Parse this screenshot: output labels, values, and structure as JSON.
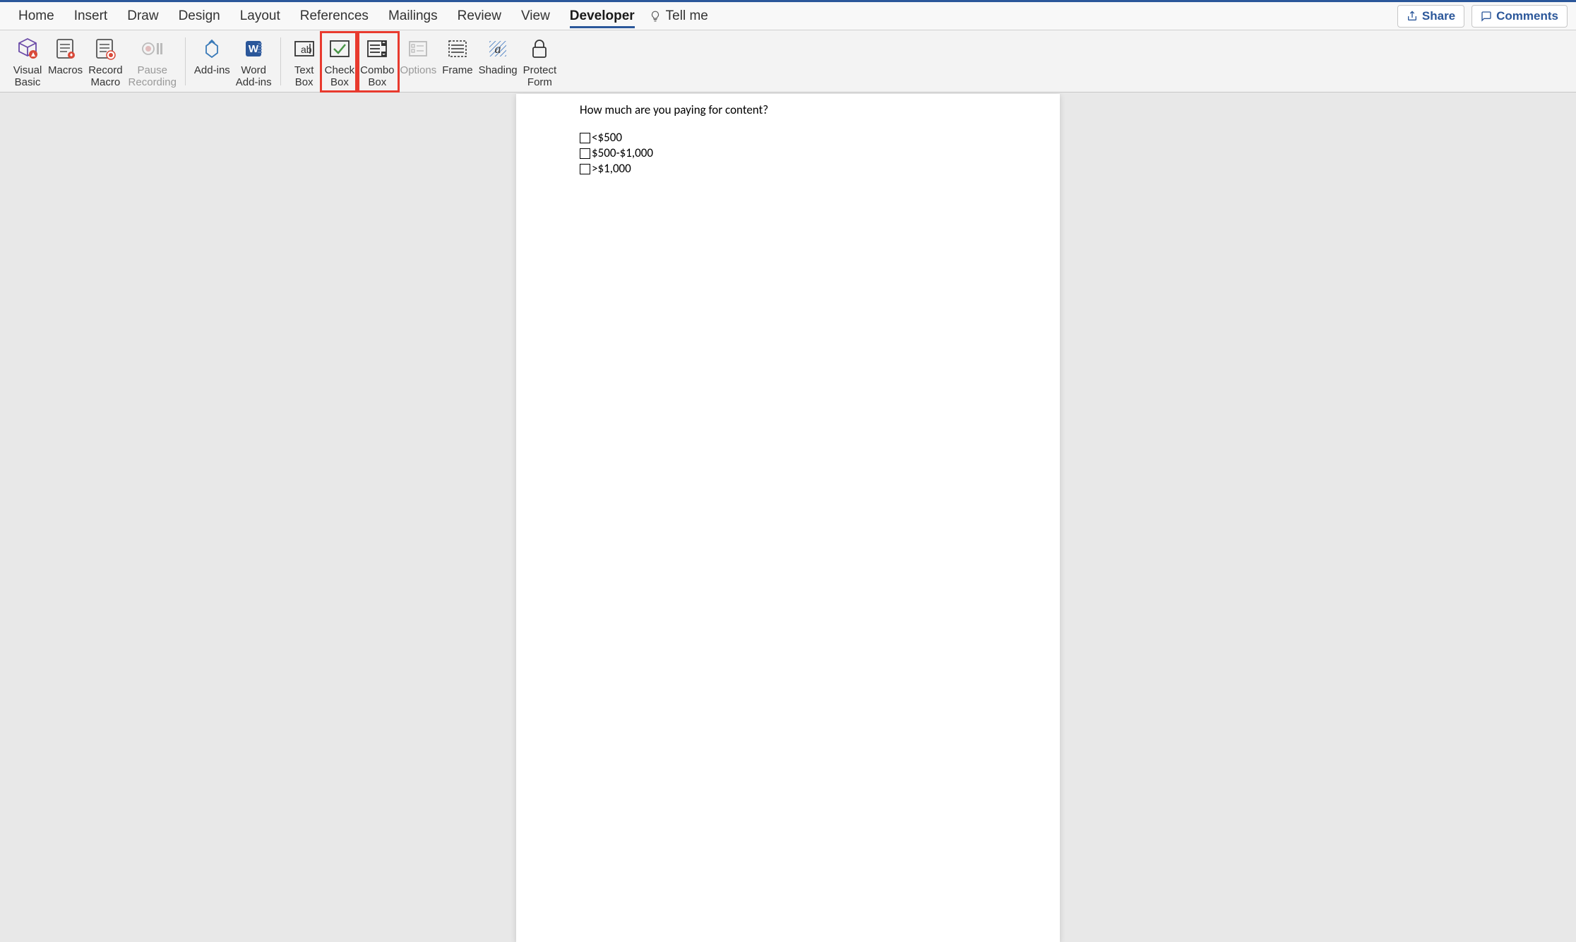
{
  "tabs": {
    "home": "Home",
    "insert": "Insert",
    "draw": "Draw",
    "design": "Design",
    "layout": "Layout",
    "references": "References",
    "mailings": "Mailings",
    "review": "Review",
    "view": "View",
    "developer": "Developer",
    "tellme": "Tell me"
  },
  "actions": {
    "share": "Share",
    "comments": "Comments"
  },
  "toolbar": {
    "visual_basic": "Visual\nBasic",
    "macros": "Macros",
    "record_macro": "Record\nMacro",
    "pause_recording": "Pause\nRecording",
    "addins": "Add-ins",
    "word_addins": "Word\nAdd-ins",
    "text_box": "Text\nBox",
    "check_box": "Check\nBox",
    "combo_box": "Combo\nBox",
    "options": "Options",
    "frame": "Frame",
    "shading": "Shading",
    "protect_form": "Protect\nForm"
  },
  "document": {
    "question": "How much are you paying for content?",
    "options": [
      "<$500",
      "$500-$1,000",
      ">$1,000"
    ]
  }
}
